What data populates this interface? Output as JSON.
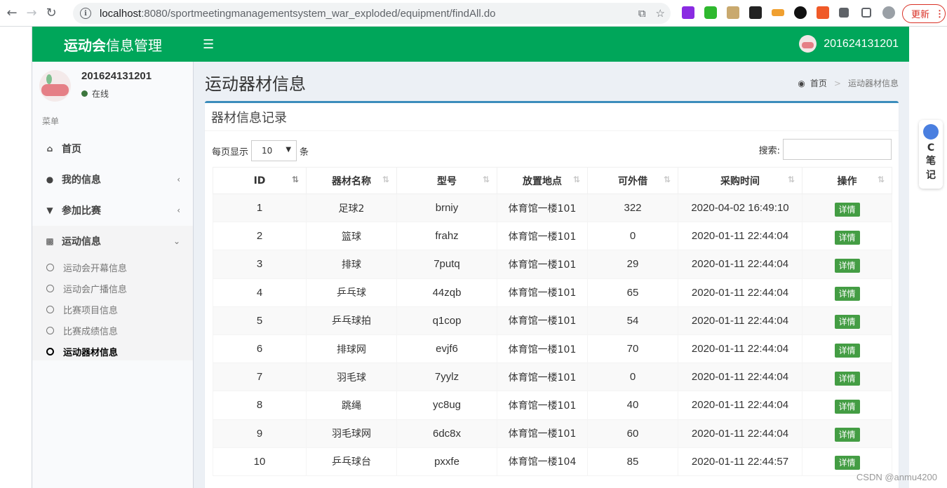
{
  "browser": {
    "url_host": "localhost",
    "url_rest": ":8080/sportmeetingmanagementsystem_war_exploded/equipment/findAll.do",
    "update_label": "更新"
  },
  "app": {
    "logo_bold": "运动会",
    "logo_rest": "信息管理",
    "top_user": "201624131201"
  },
  "sidebar": {
    "user_name": "201624131201",
    "status": "在线",
    "menu_header": "菜单",
    "items": [
      {
        "label": "首页",
        "icon": "home-icon"
      },
      {
        "label": "我的信息",
        "icon": "user-icon"
      },
      {
        "label": "参加比赛",
        "icon": "trophy-icon"
      },
      {
        "label": "运动信息",
        "icon": "bar-chart-icon"
      }
    ],
    "subitems": [
      {
        "label": "运动会开幕信息"
      },
      {
        "label": "运动会广播信息"
      },
      {
        "label": "比赛项目信息"
      },
      {
        "label": "比赛成绩信息"
      },
      {
        "label": "运动器材信息"
      }
    ]
  },
  "content": {
    "title": "运动器材信息",
    "breadcrumb": {
      "home": "首页",
      "current": "运动器材信息"
    },
    "box_title": "器材信息记录",
    "length_prefix": "每页显示",
    "length_value": "10",
    "length_suffix": "条",
    "search_label": "搜索:",
    "columns": [
      "ID",
      "器材名称",
      "型号",
      "放置地点",
      "可外借",
      "采购时间",
      "操作"
    ],
    "action_label": "详情",
    "rows": [
      {
        "id": "1",
        "name": "足球2",
        "model": "brniy",
        "location": "体育馆一楼101",
        "lendable": "322",
        "time": "2020-04-02 16:49:10"
      },
      {
        "id": "2",
        "name": "篮球",
        "model": "frahz",
        "location": "体育馆一楼101",
        "lendable": "0",
        "time": "2020-01-11 22:44:04"
      },
      {
        "id": "3",
        "name": "排球",
        "model": "7putq",
        "location": "体育馆一楼101",
        "lendable": "29",
        "time": "2020-01-11 22:44:04"
      },
      {
        "id": "4",
        "name": "乒乓球",
        "model": "44zqb",
        "location": "体育馆一楼101",
        "lendable": "65",
        "time": "2020-01-11 22:44:04"
      },
      {
        "id": "5",
        "name": "乒乓球拍",
        "model": "q1cop",
        "location": "体育馆一楼101",
        "lendable": "54",
        "time": "2020-01-11 22:44:04"
      },
      {
        "id": "6",
        "name": "排球网",
        "model": "evjf6",
        "location": "体育馆一楼101",
        "lendable": "70",
        "time": "2020-01-11 22:44:04"
      },
      {
        "id": "7",
        "name": "羽毛球",
        "model": "7yylz",
        "location": "体育馆一楼101",
        "lendable": "0",
        "time": "2020-01-11 22:44:04"
      },
      {
        "id": "8",
        "name": "跳绳",
        "model": "yc8ug",
        "location": "体育馆一楼101",
        "lendable": "40",
        "time": "2020-01-11 22:44:04"
      },
      {
        "id": "9",
        "name": "羽毛球网",
        "model": "6dc8x",
        "location": "体育馆一楼101",
        "lendable": "60",
        "time": "2020-01-11 22:44:04"
      },
      {
        "id": "10",
        "name": "乒乓球台",
        "model": "pxxfe",
        "location": "体育馆一楼104",
        "lendable": "85",
        "time": "2020-01-11 22:44:57"
      }
    ]
  },
  "overlay": {
    "note_label_1": "C",
    "note_label_2": "笔",
    "note_label_3": "记",
    "watermark": "CSDN @anmu4200"
  },
  "colors": {
    "topbar": "#00a65a",
    "box_accent": "#3c8dbc",
    "detail_button": "#449d44"
  }
}
